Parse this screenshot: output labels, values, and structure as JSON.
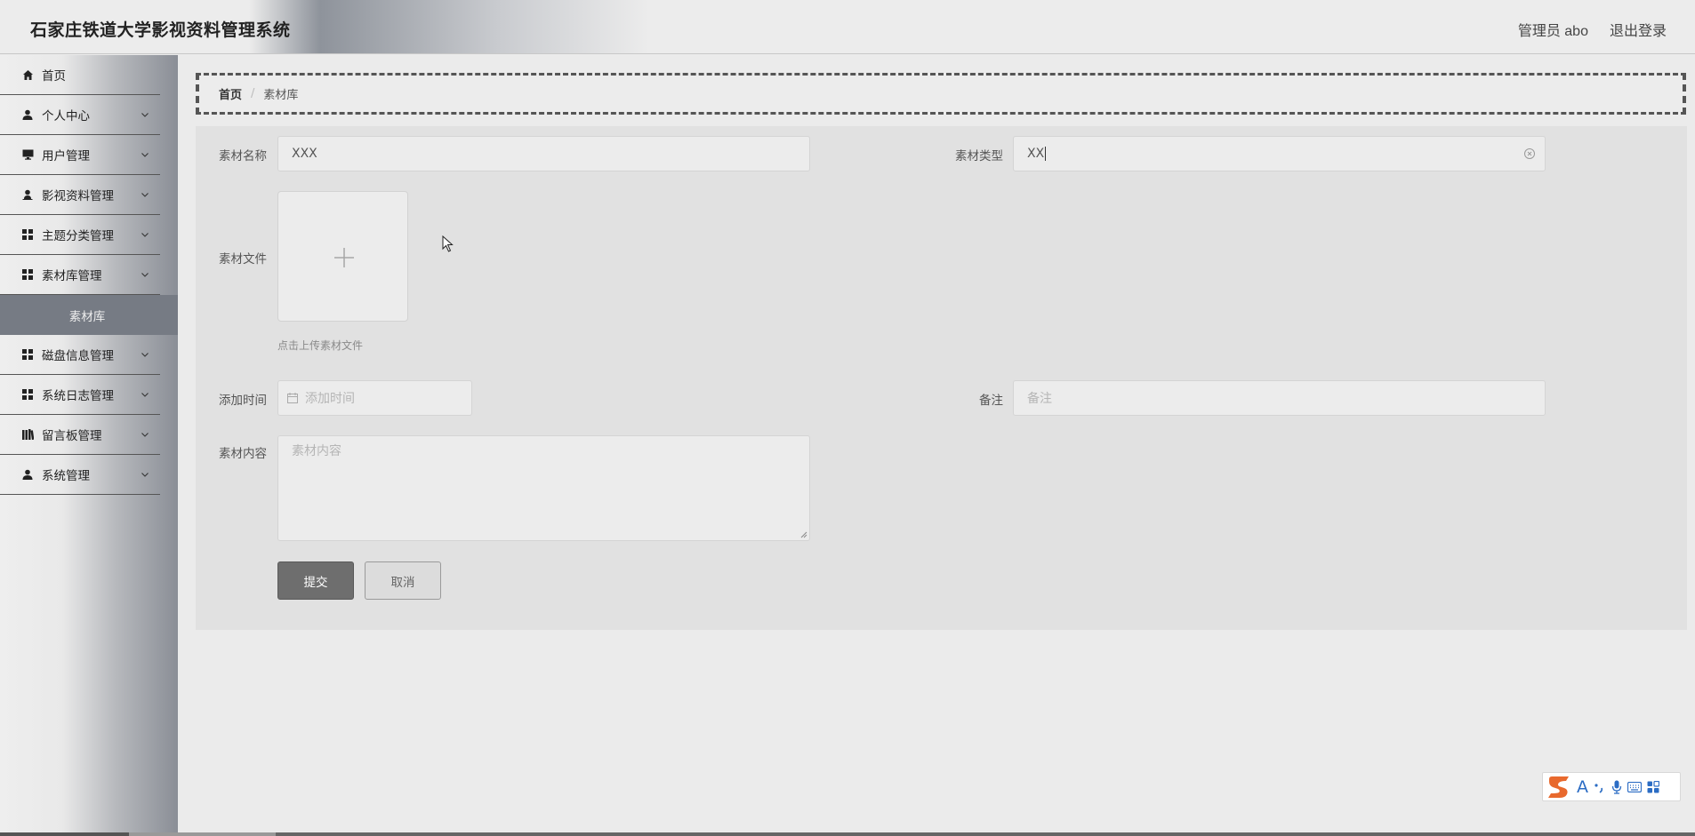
{
  "header": {
    "app_title": "石家庄铁道大学影视资料管理系统",
    "user_label": "管理员 abo",
    "logout_label": "退出登录"
  },
  "sidebar": {
    "items": [
      {
        "label": "首页",
        "icon": "home-icon"
      },
      {
        "label": "个人中心",
        "icon": "user-icon"
      },
      {
        "label": "用户管理",
        "icon": "monitor-icon"
      },
      {
        "label": "影视资料管理",
        "icon": "user-icon"
      },
      {
        "label": "主题分类管理",
        "icon": "grid-icon"
      },
      {
        "label": "素材库管理",
        "icon": "grid-icon"
      },
      {
        "label": "磁盘信息管理",
        "icon": "grid-icon"
      },
      {
        "label": "系统日志管理",
        "icon": "grid-icon"
      },
      {
        "label": "留言板管理",
        "icon": "books-icon"
      },
      {
        "label": "系统管理",
        "icon": "user-icon"
      }
    ],
    "active_sub_item": "素材库"
  },
  "breadcrumb": {
    "home": "首页",
    "separator": "/",
    "current": "素材库"
  },
  "form": {
    "name_label": "素材名称",
    "name_value": "XXX",
    "type_label": "素材类型",
    "type_value": "XX",
    "file_label": "素材文件",
    "upload_tip": "点击上传素材文件",
    "time_label": "添加时间",
    "time_placeholder": "添加时间",
    "remark_label": "备注",
    "remark_placeholder": "备注",
    "content_label": "素材内容",
    "content_placeholder": "素材内容",
    "submit_label": "提交",
    "cancel_label": "取消"
  },
  "colors": {
    "submit_bg": "#6e6e6e",
    "panel_bg": "#e1e1e1",
    "active_submenu_bg": "#767b84",
    "ime_accent": "#2b6cc4",
    "ime_logo": "#e8692d"
  }
}
